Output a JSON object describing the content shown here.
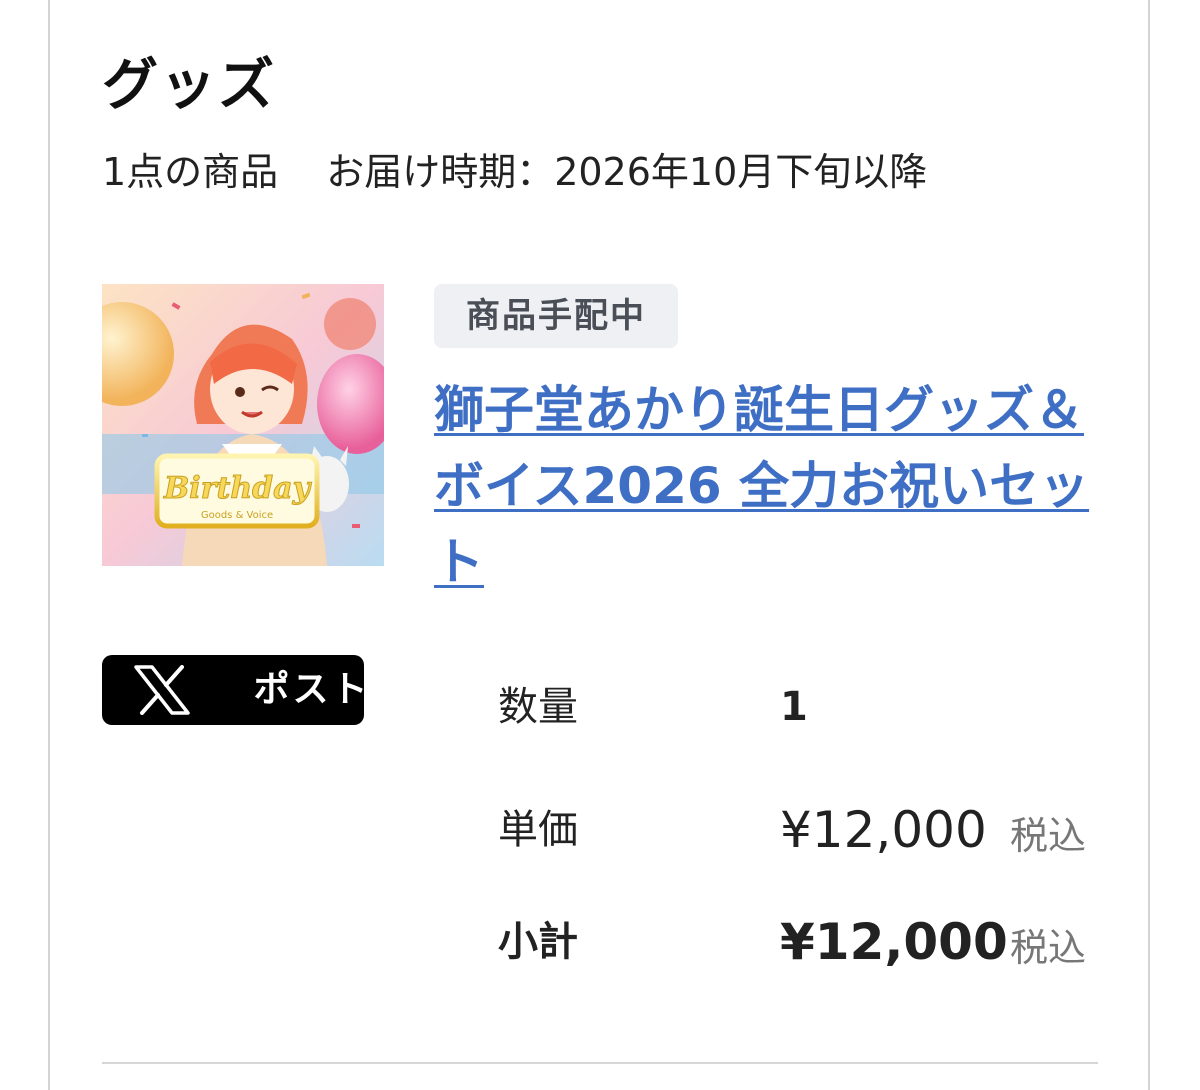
{
  "section": {
    "title": "グッズ",
    "item_count": "1点の商品",
    "delivery": "お届け時期：2026年10月下旬以降"
  },
  "product": {
    "status": "商品手配中",
    "title": "獅子堂あかり誕生日グッズ＆ボイス2026 全力お祝いセット",
    "thumbnail_text": "Birthday",
    "thumbnail_subtext": "Goods & Voice"
  },
  "share": {
    "icon": "x-logo-icon",
    "label": "ポスト"
  },
  "details": {
    "quantity_label": "数量",
    "quantity_value": "1",
    "unit_price_label": "単価",
    "unit_price_value": "¥12,000",
    "unit_price_tax": "税込",
    "subtotal_label": "小計",
    "subtotal_value": "¥12,000",
    "subtotal_tax": "税込"
  },
  "colors": {
    "link": "#3f6fc4",
    "badge_bg": "#eef0f3",
    "badge_text": "#4a4f57",
    "button_bg": "#000000"
  }
}
